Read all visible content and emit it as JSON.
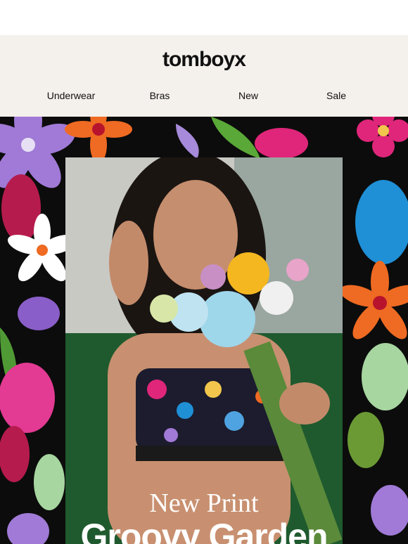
{
  "brand": {
    "logo_text": "tomboyx"
  },
  "nav": {
    "items": [
      "Underwear",
      "Bras",
      "New",
      "Sale"
    ]
  },
  "hero": {
    "line1": "New Print",
    "line2": "Groovy Garden"
  },
  "colors": {
    "header_bg": "#f4f0ec",
    "text": "#111111",
    "hero_text": "#ffffff"
  }
}
